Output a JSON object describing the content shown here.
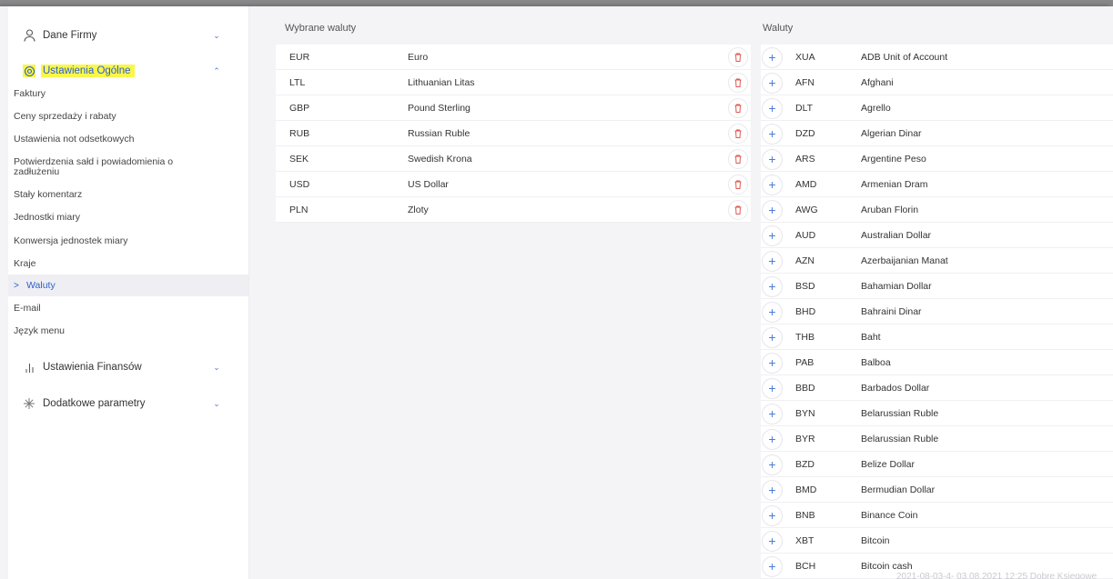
{
  "sidebar": {
    "sections": [
      {
        "label": "Dane Firmy",
        "icon": "user-icon"
      },
      {
        "label": "Ustawienia Ogólne",
        "icon": "settings-icon"
      },
      {
        "label": "Ustawienia Finansów",
        "icon": "bar-chart-icon"
      },
      {
        "label": "Dodatkowe parametry",
        "icon": "snowflake-icon"
      }
    ],
    "items": [
      {
        "label": "Faktury"
      },
      {
        "label": "Ceny sprzedaży i rabaty"
      },
      {
        "label": "Ustawienia not odsetkowych"
      },
      {
        "label": "Potwierdzenia sałd i powiadomienia o zadłużeniu"
      },
      {
        "label": "Stały komentarz"
      },
      {
        "label": "Jednostki miary"
      },
      {
        "label": "Konwersja jednostek miary"
      },
      {
        "label": "Kraje"
      },
      {
        "label": "Waluty"
      },
      {
        "label": "E-mail"
      },
      {
        "label": "Język menu"
      }
    ],
    "selected_arrow": ">",
    "highlight_color": "#f8f74a",
    "accent_color": "#2f5fd0"
  },
  "selected_panel": {
    "title": "Wybrane waluty",
    "rows": [
      {
        "code": "EUR",
        "name": "Euro"
      },
      {
        "code": "LTL",
        "name": "Lithuanian Litas"
      },
      {
        "code": "GBP",
        "name": "Pound Sterling"
      },
      {
        "code": "RUB",
        "name": "Russian Ruble"
      },
      {
        "code": "SEK",
        "name": "Swedish Krona"
      },
      {
        "code": "USD",
        "name": "US Dollar"
      },
      {
        "code": "PLN",
        "name": "Zloty"
      }
    ],
    "delete_icon": "trash-icon",
    "delete_color": "#e0584f"
  },
  "all_panel": {
    "title": "Waluty",
    "add_symbol": "+",
    "rows": [
      {
        "code": "XUA",
        "name": "ADB Unit of Account"
      },
      {
        "code": "AFN",
        "name": "Afghani"
      },
      {
        "code": "DLT",
        "name": "Agrello"
      },
      {
        "code": "DZD",
        "name": "Algerian Dinar"
      },
      {
        "code": "ARS",
        "name": "Argentine Peso"
      },
      {
        "code": "AMD",
        "name": "Armenian Dram"
      },
      {
        "code": "AWG",
        "name": "Aruban Florin"
      },
      {
        "code": "AUD",
        "name": "Australian Dollar"
      },
      {
        "code": "AZN",
        "name": "Azerbaijanian Manat"
      },
      {
        "code": "BSD",
        "name": "Bahamian Dollar"
      },
      {
        "code": "BHD",
        "name": "Bahraini Dinar"
      },
      {
        "code": "THB",
        "name": "Baht"
      },
      {
        "code": "PAB",
        "name": "Balboa"
      },
      {
        "code": "BBD",
        "name": "Barbados Dollar"
      },
      {
        "code": "BYN",
        "name": "Belarussian Ruble"
      },
      {
        "code": "BYR",
        "name": "Belarussian Ruble"
      },
      {
        "code": "BZD",
        "name": "Belize Dollar"
      },
      {
        "code": "BMD",
        "name": "Bermudian Dollar"
      },
      {
        "code": "BNB",
        "name": "Binance Coin"
      },
      {
        "code": "XBT",
        "name": "Bitcoin"
      },
      {
        "code": "BCH",
        "name": "Bitcoin cash"
      }
    ]
  },
  "footer": {
    "text": "2021-08-03-4- 03.08.2021 12:25 Dobre Księgowe"
  }
}
